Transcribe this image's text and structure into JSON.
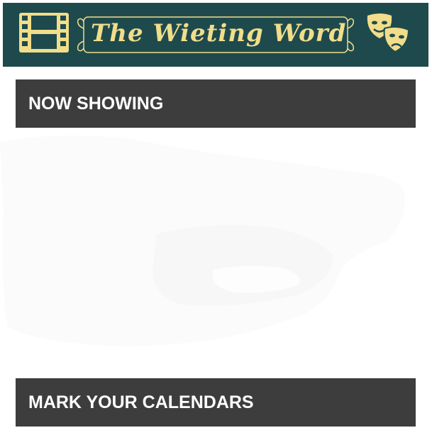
{
  "banner": {
    "title": "The Wieting Word",
    "left_icon": "film-strip-icon",
    "right_icon": "theater-masks-icon",
    "colors": {
      "background": "#1e4a4d",
      "accent": "#f1dd8a"
    }
  },
  "sections": {
    "now_showing": "NOW SHOWING",
    "mark_your_calendars": "MARK YOUR CALENDARS"
  },
  "colors": {
    "section_header_bg": "#3d3d3d",
    "section_header_text": "#ffffff"
  }
}
